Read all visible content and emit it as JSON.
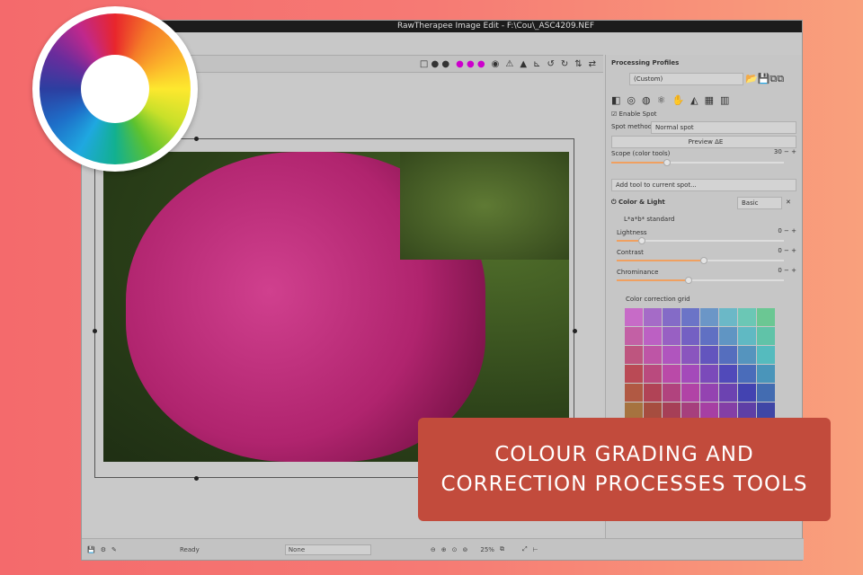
{
  "window": {
    "title": "RawTherapee Image Edit - F:\\Cou\\_ASC4209.NEF"
  },
  "panel": {
    "profiles_label": "Processing Profiles",
    "profile_value": "(Custom)",
    "enable_spot": "Enable Spot",
    "spot_method_label": "Spot method:",
    "spot_method_value": "Normal spot",
    "preview_button": "Preview ΔE",
    "scope_label": "Scope (color tools)",
    "scope_value": "30",
    "scope_fraction": 0.3,
    "add_tool": "Add tool to current spot...",
    "color_light": "Color & Light",
    "complexity": "Basic",
    "lab_mode": "L*a*b* standard",
    "sliders": [
      {
        "label": "Lightness",
        "value": "0",
        "fraction": 0.13
      },
      {
        "label": "Contrast",
        "value": "0",
        "fraction": 0.5
      },
      {
        "label": "Chrominance",
        "value": "0",
        "fraction": 0.41
      }
    ],
    "grid_title": "Color correction grid"
  },
  "status": {
    "text": "Ready",
    "preview_select": "None",
    "zoom": "25%"
  },
  "banner": {
    "line1": "COLOUR GRADING AND",
    "line2": "CORRECTION PROCESSES TOOLS"
  }
}
